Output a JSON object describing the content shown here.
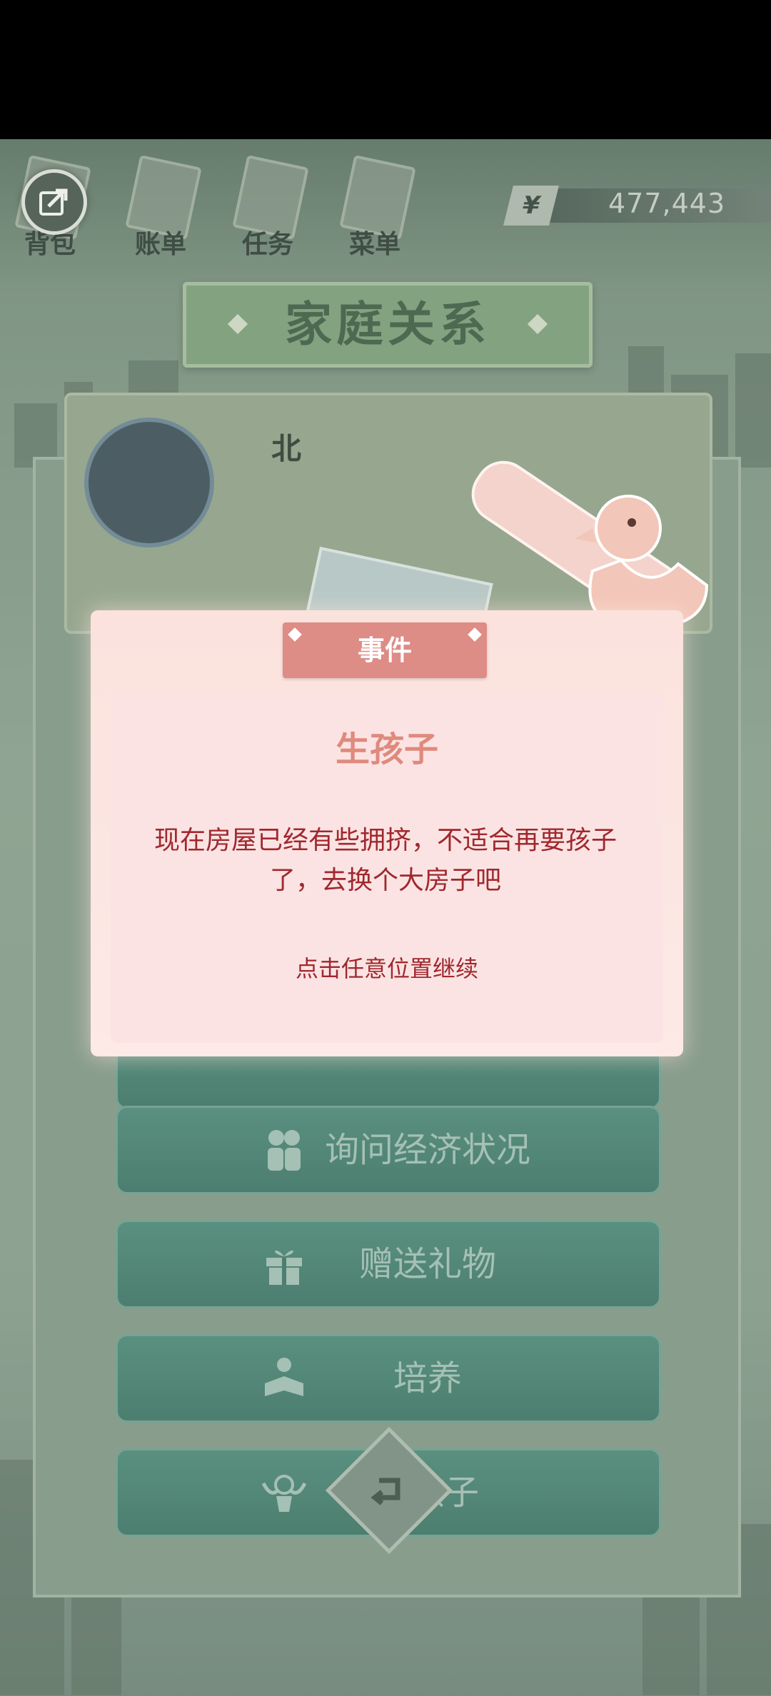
{
  "nav": {
    "items": [
      {
        "label": "背包",
        "icon": "backpack-icon"
      },
      {
        "label": "账单",
        "icon": "bill-icon"
      },
      {
        "label": "任务",
        "icon": "task-icon"
      },
      {
        "label": "菜单",
        "icon": "menu-icon"
      }
    ],
    "money": {
      "currency_symbol": "¥",
      "value": "477,443"
    }
  },
  "page": {
    "title": "家庭关系"
  },
  "profile": {
    "name_partial": "北"
  },
  "actions": [
    {
      "label": "询问经济状况",
      "icon": "couple-icon"
    },
    {
      "label": "赠送礼物",
      "icon": "gift-icon"
    },
    {
      "label": "培养",
      "icon": "reading-child-icon"
    },
    {
      "label": "生孩子",
      "icon": "angel-icon"
    }
  ],
  "modal": {
    "tag": "事件",
    "title": "生孩子",
    "body": "现在房屋已经有些拥挤，不适合再要孩子了，去换个大房子吧",
    "hint": "点击任意位置继续"
  },
  "colors": {
    "accent": "#de8c86",
    "body_text": "#a0282e",
    "button": "#4d8b7c"
  }
}
